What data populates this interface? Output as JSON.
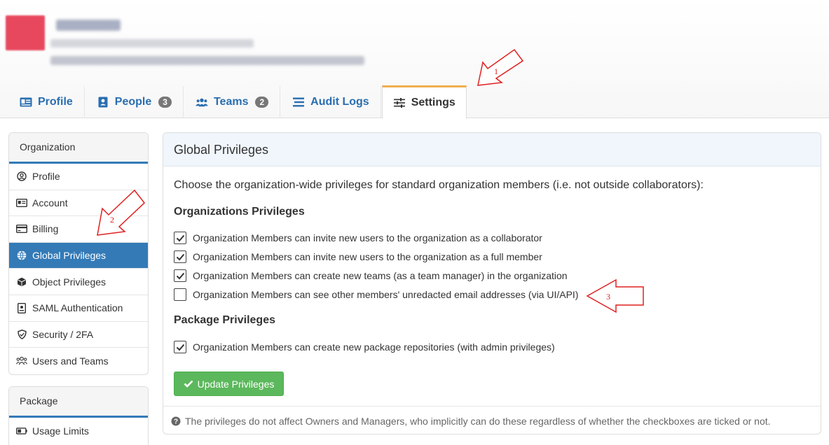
{
  "tabs": [
    {
      "label": "Profile",
      "icon": "id-card-icon"
    },
    {
      "label": "People",
      "icon": "person-badge-icon",
      "badge": "3"
    },
    {
      "label": "Teams",
      "icon": "users-icon",
      "badge": "2"
    },
    {
      "label": "Audit Logs",
      "icon": "list-icon"
    },
    {
      "label": "Settings",
      "icon": "sliders-icon",
      "active": true
    }
  ],
  "sidebar": {
    "organization": {
      "title": "Organization",
      "items": [
        {
          "label": "Profile",
          "icon": "user-circle-icon"
        },
        {
          "label": "Account",
          "icon": "id-card-icon"
        },
        {
          "label": "Billing",
          "icon": "credit-card-icon"
        },
        {
          "label": "Global Privileges",
          "icon": "globe-icon",
          "active": true
        },
        {
          "label": "Object Privileges",
          "icon": "cube-icon"
        },
        {
          "label": "SAML Authentication",
          "icon": "badge-icon"
        },
        {
          "label": "Security / 2FA",
          "icon": "shield-icon"
        },
        {
          "label": "Users and Teams",
          "icon": "users-icon"
        }
      ]
    },
    "package": {
      "title": "Package",
      "items": [
        {
          "label": "Usage Limits",
          "icon": "battery-icon"
        }
      ]
    }
  },
  "main": {
    "title": "Global Privileges",
    "intro": "Choose the organization-wide privileges for standard organization members (i.e. not outside collaborators):",
    "org_section": "Organizations Privileges",
    "org_privileges": [
      {
        "label": "Organization Members can invite new users to the organization as a collaborator",
        "checked": true
      },
      {
        "label": "Organization Members can invite new users to the organization as a full member",
        "checked": true
      },
      {
        "label": "Organization Members can create new teams (as a team manager) in the organization",
        "checked": true
      },
      {
        "label": "Organization Members can see other members' unredacted email addresses (via UI/API)",
        "checked": false
      }
    ],
    "package_section": "Package Privileges",
    "package_privileges": [
      {
        "label": "Organization Members can create new package repositories (with admin privileges)",
        "checked": true
      }
    ],
    "update_button": "Update Privileges",
    "footer_note": "The privileges do not affect Owners and Managers, who implicitly can do these regardless of whether the checkboxes are ticked or not."
  },
  "annotations": {
    "arrow1": "1",
    "arrow2": "2",
    "arrow3": "3"
  },
  "colors": {
    "link": "#2a6eb0",
    "active_tab_accent": "#f0ad4e",
    "sidebar_active": "#337ab7",
    "button_green": "#5cb85c",
    "annotation_red": "#e02020"
  }
}
